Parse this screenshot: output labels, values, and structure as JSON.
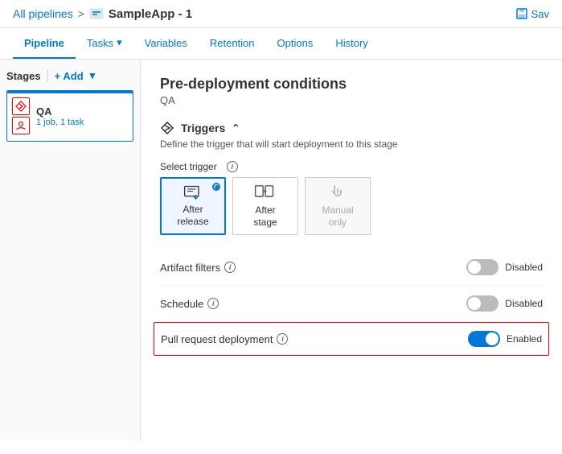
{
  "topbar": {
    "breadcrumb_link": "All pipelines",
    "breadcrumb_sep": ">",
    "app_name": "SampleApp - 1",
    "save_label": "Sav"
  },
  "nav": {
    "tabs": [
      {
        "label": "Pipeline",
        "active": true
      },
      {
        "label": "Tasks",
        "has_arrow": true
      },
      {
        "label": "Variables"
      },
      {
        "label": "Retention"
      },
      {
        "label": "Options"
      },
      {
        "label": "History"
      }
    ]
  },
  "sidebar": {
    "title": "Stages",
    "add_label": "+ Add",
    "stage": {
      "name": "QA",
      "meta": "1 job, 1 task"
    }
  },
  "content": {
    "title": "Pre-deployment conditions",
    "subtitle": "QA",
    "triggers_section": {
      "header": "Triggers",
      "description": "Define the trigger that will start deployment to this stage",
      "select_label": "Select trigger",
      "cards": [
        {
          "id": "after-release",
          "label": "After\nrelease",
          "selected": true
        },
        {
          "id": "after-stage",
          "label": "After\nstage",
          "selected": false
        },
        {
          "id": "manual-only",
          "label": "Manual\nonly",
          "selected": false,
          "disabled": true
        }
      ]
    },
    "toggles": [
      {
        "id": "artifact-filters",
        "label": "Artifact filters",
        "state": "off",
        "status": "Disabled"
      },
      {
        "id": "schedule",
        "label": "Schedule",
        "state": "off",
        "status": "Disabled"
      },
      {
        "id": "pull-request",
        "label": "Pull request deployment",
        "state": "on",
        "status": "Enabled",
        "highlighted": true
      }
    ]
  }
}
